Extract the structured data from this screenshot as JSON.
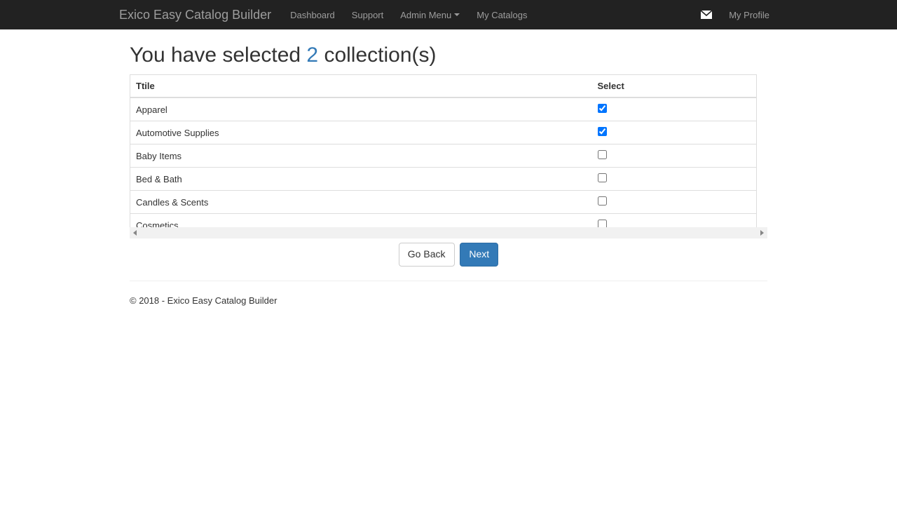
{
  "navbar": {
    "brand": "Exico Easy Catalog Builder",
    "items": {
      "dashboard": "Dashboard",
      "support": "Support",
      "admin_menu": "Admin Menu",
      "my_catalogs": "My Catalogs",
      "my_profile": "My Profile"
    }
  },
  "heading": {
    "prefix": "You have selected ",
    "count": "2",
    "suffix": " collection(s)"
  },
  "table": {
    "headers": {
      "title": "Ttile",
      "select": "Select"
    },
    "rows": [
      {
        "title": "Apparel",
        "selected": true
      },
      {
        "title": "Automotive Supplies",
        "selected": true
      },
      {
        "title": "Baby Items",
        "selected": false
      },
      {
        "title": "Bed & Bath",
        "selected": false
      },
      {
        "title": "Candles & Scents",
        "selected": false
      },
      {
        "title": "Cosmetics",
        "selected": false
      }
    ]
  },
  "buttons": {
    "back": "Go Back",
    "next": "Next"
  },
  "footer": "© 2018 - Exico Easy Catalog Builder"
}
